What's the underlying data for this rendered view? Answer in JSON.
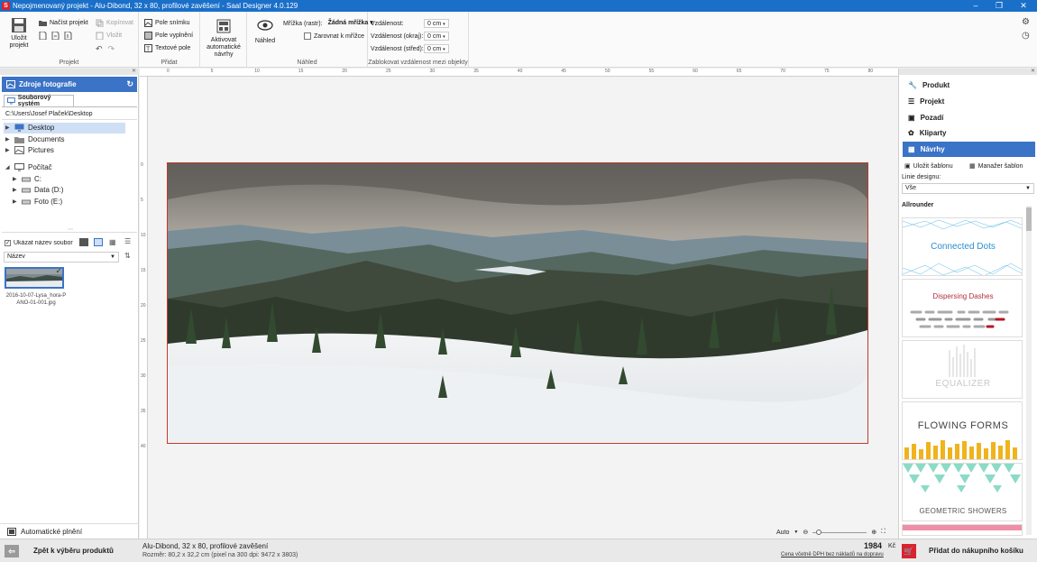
{
  "titlebar": {
    "title": "Nepojmenovaný projekt - Alu-Dibond, 32 x 80, profilové zavěšení - Saal Designer 4.0.129",
    "app_icon": "S"
  },
  "ribbon": {
    "projekt": {
      "save_label": "Uložit projekt",
      "load_label": "Načíst projekt",
      "copy_label": "Kopírovat",
      "paste_label": "Vložit",
      "group_label": "Projekt"
    },
    "pridat": {
      "photo_field": "Pole snímku",
      "fill_field": "Pole vyplnění",
      "text_field": "Textové pole",
      "group_label": "Přidat"
    },
    "auto": {
      "label": "Aktivovat automatické návrhy"
    },
    "nahled": {
      "preview_label": "Náhled",
      "grid_label": "Mřížka (rastr):",
      "grid_value": "Žádná mřížka",
      "snap_label": "Zarovnat k mřížce",
      "group_label": "Náhled"
    },
    "spacing": {
      "distance_label": "Vzdálenost:",
      "distance_value": "0 cm",
      "edge_label": "Vzdálenost (okraj):",
      "edge_value": "0 cm",
      "center_label": "Vzdálenost (střed):",
      "center_value": "0 cm",
      "group_label": "Zablokovat vzdálenost mezi objekty"
    }
  },
  "left": {
    "header": "Zdroje fotografie",
    "tab": "Souborový systém",
    "path": "C:\\Users\\Josef Plaček\\Desktop",
    "folders": [
      "Desktop",
      "Documents",
      "Pictures"
    ],
    "computer": "Počítač",
    "drives": [
      "C:",
      "Data (D:)",
      "Foto (E:)"
    ],
    "show_names_label": "Ukázat název souboru",
    "sort_label": "Název",
    "thumb_caption": "2016-10-07-Lysa_hora-PANO-01-001.jpg",
    "auto_fill_label": "Automatické plnění"
  },
  "center": {
    "ruler_ticks": [
      "0",
      "5",
      "10",
      "15",
      "20",
      "25",
      "30",
      "35",
      "40",
      "45",
      "50",
      "55",
      "60",
      "65",
      "70",
      "75",
      "80"
    ],
    "ruler_v_ticks": [
      "0",
      "5",
      "10",
      "15",
      "20",
      "25",
      "30",
      "35",
      "40"
    ],
    "zoom_label": "Auto"
  },
  "right": {
    "nav": [
      "Produkt",
      "Projekt",
      "Pozadí",
      "Kliparty",
      "Návrhy"
    ],
    "save_template": "Uložit šablonu",
    "template_manager": "Manažer šablon",
    "design_line_label": "Linie designu:",
    "design_line_value": "Vše",
    "category": "Allrounder",
    "designs": [
      "Connected Dots",
      "Dispersing Dashes",
      "EQUALIZER",
      "FLOWING FORMS",
      "GEOMETRIC SHOWERS"
    ]
  },
  "bottom": {
    "back_label": "Zpět k výběru produktů",
    "product": "Alu-Dibond, 32 x 80, profilové zavěšení",
    "size": "Rozměr: 80,2 x 32,2 cm (pixel na 300 dpi: 9472 x 3803)",
    "price": "1984",
    "currency": "Kč",
    "price_note": "Cena včetně DPH bez nákladů na dopravu",
    "cart_label": "Přidat do nákupního košíku"
  },
  "colors": {
    "accent": "#3b73c6",
    "title": "#1a6fc9",
    "cart": "#d9232e"
  }
}
